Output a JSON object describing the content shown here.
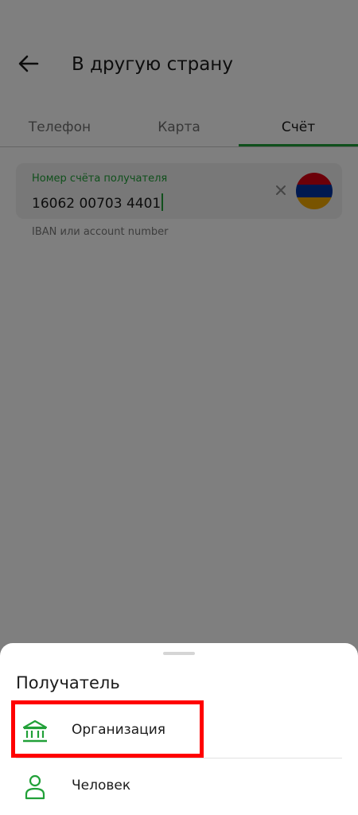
{
  "header": {
    "title": "В другую страну"
  },
  "tabs": [
    {
      "label": "Телефон"
    },
    {
      "label": "Карта"
    },
    {
      "label": "Счёт"
    }
  ],
  "account_field": {
    "label": "Номер счёта получателя",
    "value": "16062 00703 4401",
    "hint": "IBAN или account number"
  },
  "bottom_sheet": {
    "title": "Получатель",
    "options": [
      {
        "label": "Организация",
        "icon": "bank-icon"
      },
      {
        "label": "Человек",
        "icon": "person-icon"
      }
    ]
  },
  "colors": {
    "accent": "#21a038",
    "highlight": "#ff0000",
    "flag_red": "#d90012",
    "flag_blue": "#0033a0",
    "flag_orange": "#f2a800"
  }
}
